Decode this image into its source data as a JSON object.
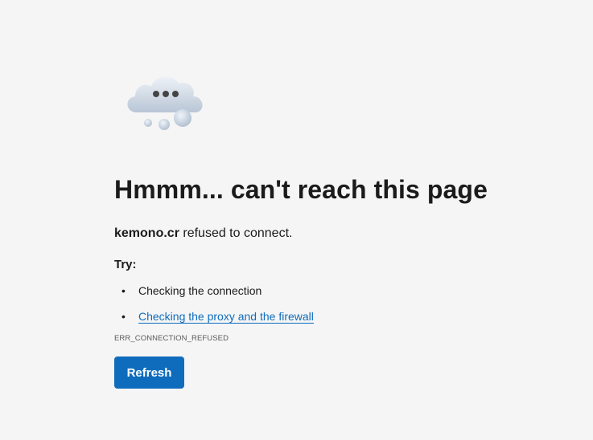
{
  "illustration": {
    "icon": "cloud-loading-icon"
  },
  "error": {
    "title": "Hmmm... can't reach this page",
    "host": "kemono.cr",
    "message_suffix": " refused to connect.",
    "try_label": "Try:",
    "suggestions": [
      {
        "label": "Checking the connection",
        "is_link": false
      },
      {
        "label": "Checking the proxy and the firewall",
        "is_link": true
      }
    ],
    "code": "ERR_CONNECTION_REFUSED"
  },
  "actions": {
    "refresh_label": "Refresh"
  },
  "colors": {
    "background": "#f5f5f5",
    "accent": "#0f6cbd",
    "text": "#1b1b1b"
  }
}
